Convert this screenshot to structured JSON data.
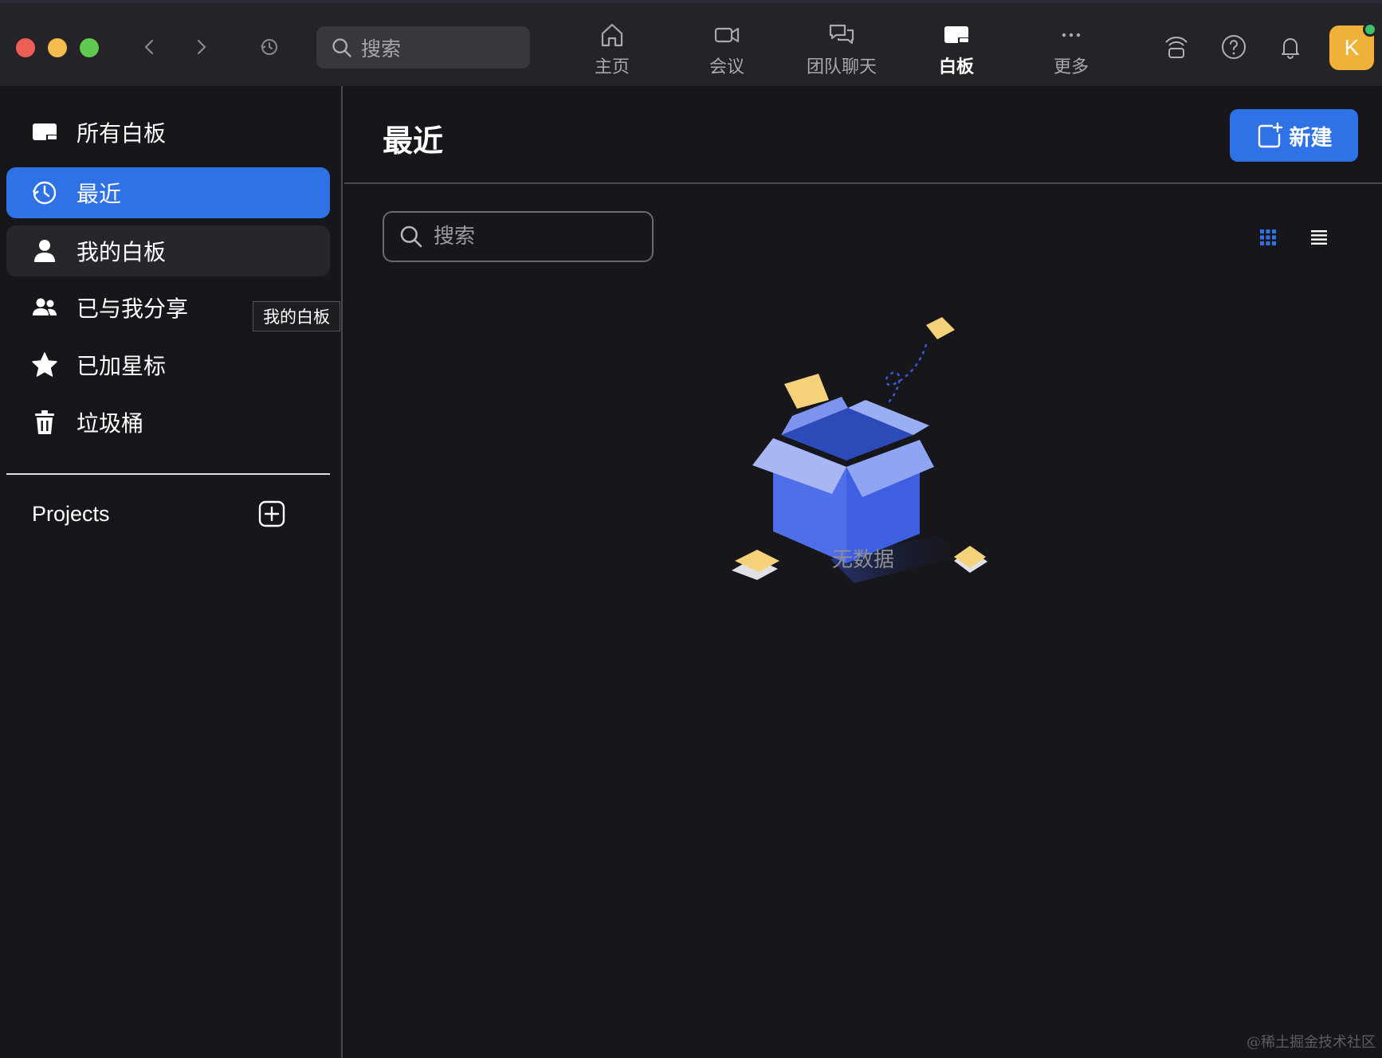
{
  "topbar": {
    "search_placeholder": "搜索",
    "tabs": [
      {
        "label": "主页",
        "icon": "home-icon",
        "active": false
      },
      {
        "label": "会议",
        "icon": "video-icon",
        "active": false
      },
      {
        "label": "团队聊天",
        "icon": "chat-icon",
        "active": false
      },
      {
        "label": "白板",
        "icon": "whiteboard-icon",
        "active": true
      },
      {
        "label": "更多",
        "icon": "more-icon",
        "active": false
      }
    ],
    "avatar_letter": "K",
    "avatar_color": "#f0b13a",
    "status_color": "#3cc26a"
  },
  "sidebar": {
    "items": [
      {
        "label": "所有白板",
        "icon": "whiteboard-icon"
      },
      {
        "label": "最近",
        "icon": "clock-icon",
        "active": true
      },
      {
        "label": "我的白板",
        "icon": "user-icon",
        "hover": true
      },
      {
        "label": "已与我分享",
        "icon": "users-icon"
      },
      {
        "label": "已加星标",
        "icon": "star-icon"
      },
      {
        "label": "垃圾桶",
        "icon": "trash-icon"
      }
    ],
    "tooltip": "我的白板",
    "projects_label": "Projects"
  },
  "main": {
    "title": "最近",
    "new_button_label": "新建",
    "search_placeholder": "搜索",
    "empty_text": "无数据",
    "accent_color": "#2f72e6"
  },
  "watermark": "@稀土掘金技术社区"
}
